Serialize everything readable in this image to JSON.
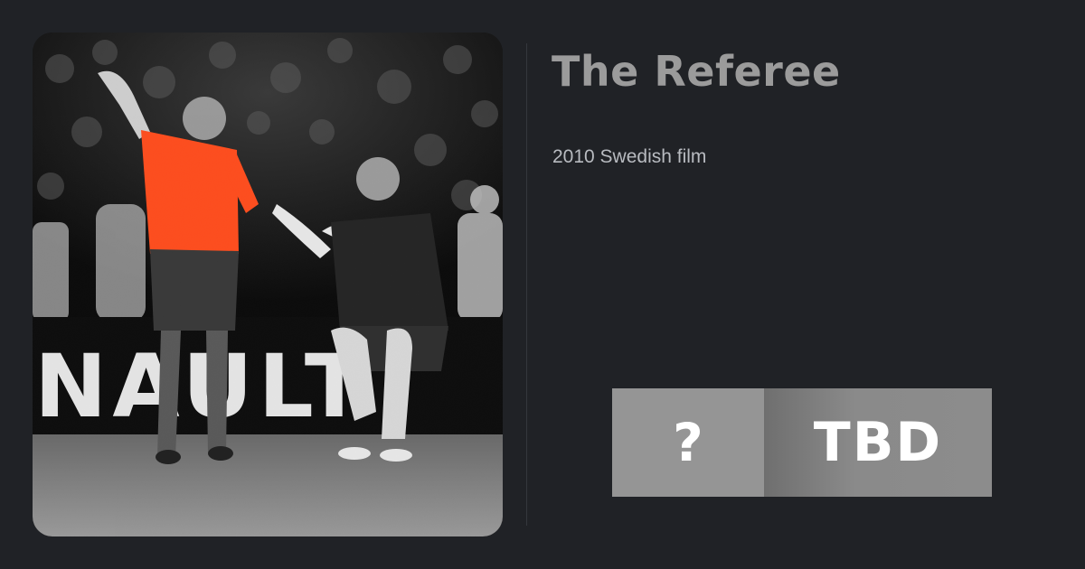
{
  "title": "The Referee",
  "subtitle": "2010 Swedish film",
  "poster": {
    "name": "film-still",
    "signage_text": "NAULT",
    "referee_shirt_color": "#ff4e1f"
  },
  "rating": {
    "score_symbol": "?",
    "score_label": "TBD"
  },
  "colors": {
    "background": "#202226",
    "title": "#9b9b9b",
    "subtitle": "#b8bbc0",
    "score_left": "#959595",
    "score_right": "#8a8a8a"
  }
}
